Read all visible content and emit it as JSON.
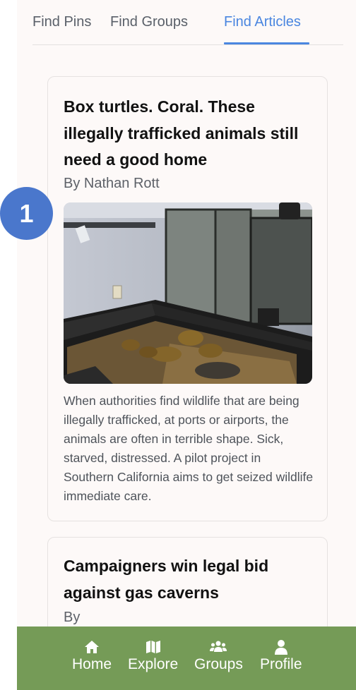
{
  "tabs": [
    {
      "label": "Find Pins"
    },
    {
      "label": "Find Groups"
    },
    {
      "label": "Find Articles"
    }
  ],
  "active_tab": "Find Articles",
  "accent_color": "#4a86e0",
  "nav_color": "#759b57",
  "badge": {
    "number": "1"
  },
  "articles": [
    {
      "title": "Box turtles. Coral. These illegally trafficked animals still need a good home",
      "author": "By Nathan Rott",
      "image_icon": "turtles-enclosure-photo",
      "description": "When authorities find wildlife that are being illegally trafficked, at ports or airports, the animals are often in terrible shape. Sick, starved, distressed. A pilot project in Southern California aims to get seized wildlife immediate care."
    },
    {
      "title": "Campaigners win legal bid against gas caverns",
      "author": "By"
    }
  ],
  "nav": [
    {
      "label": "Home",
      "icon": "home-icon"
    },
    {
      "label": "Explore",
      "icon": "map-icon"
    },
    {
      "label": "Groups",
      "icon": "users-icon"
    },
    {
      "label": "Profile",
      "icon": "user-icon"
    }
  ]
}
